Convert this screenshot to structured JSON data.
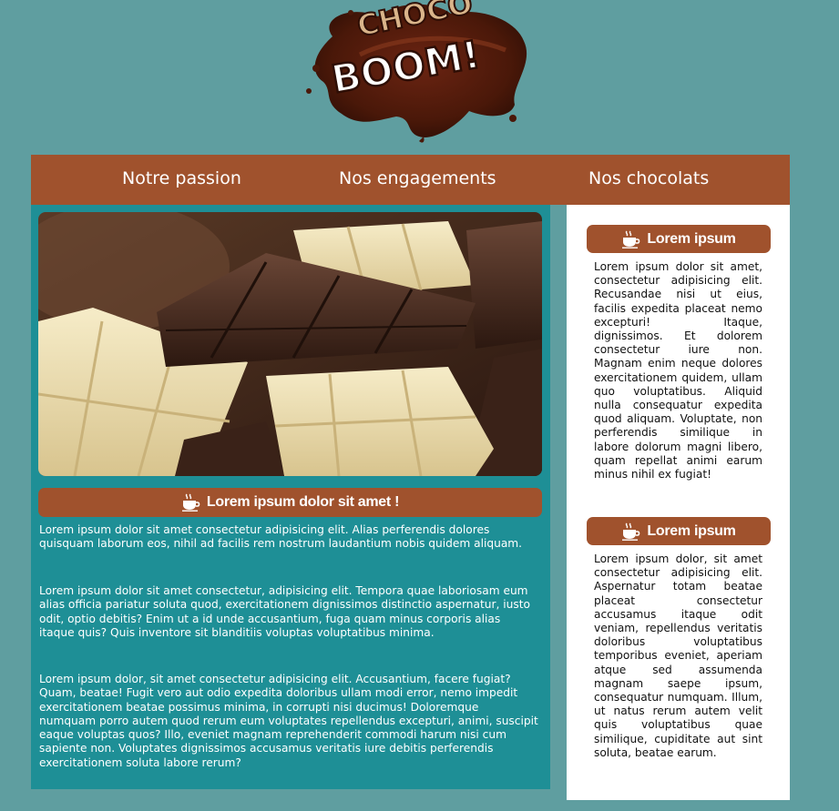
{
  "logo": {
    "top_text": "CHOCO",
    "main_text": "BOOM!",
    "alt": "Choco Boom logo"
  },
  "nav": {
    "items": [
      "Notre passion",
      "Nos engagements",
      "Nos chocolats"
    ]
  },
  "main": {
    "hero_alt": "Dark and white chocolate bars",
    "banner_title": "Lorem ipsum dolor sit amet !",
    "paragraphs": [
      "Lorem ipsum dolor sit amet consectetur adipisicing elit. Alias perferendis dolores quisquam laborum eos, nihil ad facilis rem nostrum laudantium nobis quidem aliquam.",
      "Lorem ipsum dolor sit amet consectetur, adipisicing elit. Tempora quae laboriosam eum alias officia pariatur soluta quod, exercitationem dignissimos distinctio aspernatur, iusto odit, optio debitis? Enim ut a id unde accusantium, fuga quam minus corporis alias itaque quis? Quis inventore sit blanditiis voluptas voluptatibus minima.",
      "Lorem ipsum dolor, sit amet consectetur adipisicing elit. Accusantium, facere fugiat? Quam, beatae! Fugit vero aut odio expedita doloribus ullam modi error, nemo impedit exercitationem beatae possimus minima, in corrupti nisi ducimus! Doloremque numquam porro autem quod rerum eum voluptates repellendus excepturi, animi, suscipit eaque voluptas quos? Illo, eveniet magnam reprehenderit commodi harum nisi cum sapiente non. Voluptates dignissimos accusamus veritatis iure debitis perferendis exercitationem soluta labore rerum?"
    ]
  },
  "aside": {
    "blocks": [
      {
        "title": "Lorem ipsum",
        "text": "Lorem ipsum dolor sit amet, consectetur adipisicing elit. Recusandae nisi ut eius, facilis expedita placeat nemo excepturi! Itaque, dignissimos. Et dolorem consectetur iure non. Magnam enim neque dolores exercitationem quidem, ullam quo voluptatibus. Aliquid nulla consequatur expedita quod aliquam. Voluptate, non perferendis similique in labore dolorum magni libero, quam repellat animi earum minus nihil ex fugiat!"
      },
      {
        "title": "Lorem ipsum",
        "text": "Lorem ipsum dolor, sit amet consectetur adipisicing elit. Aspernatur totam beatae placeat consectetur accusamus itaque odit veniam, repellendus veritatis doloribus voluptatibus temporibus eveniet, aperiam atque sed assumenda magnam saepe ipsum, consequatur numquam. Illum, ut natus rerum autem velit quis voluptatibus quae similique, cupiditate aut sint soluta, beatae earum."
      }
    ]
  },
  "colors": {
    "page_bg": "#5f9ea0",
    "nav_bg": "#a0522d",
    "main_bg": "#1e8f96",
    "aside_bg": "#ffffff",
    "banner_bg": "#a0522d"
  },
  "icons": {
    "banner_icon": "coffee-cup-icon"
  }
}
